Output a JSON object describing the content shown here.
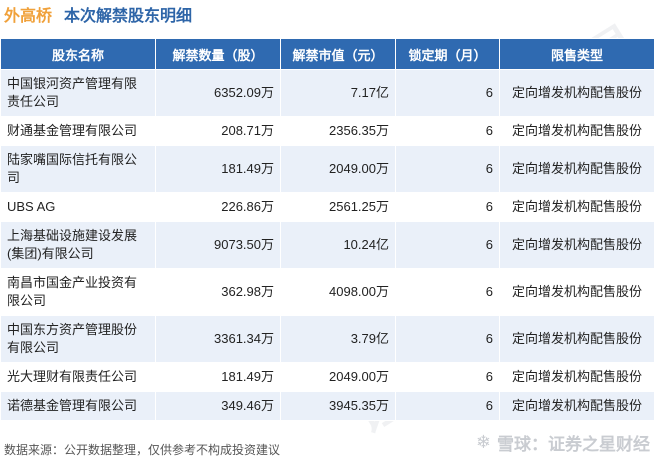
{
  "header": {
    "stock_name": "外高桥",
    "subtitle": "本次解禁股东明细"
  },
  "table": {
    "columns": [
      "股东名称",
      "解禁数量（股）",
      "解禁市值（元）",
      "锁定期（月）",
      "限售类型"
    ],
    "rows": [
      {
        "name": "中国银河资产管理有限责任公司",
        "qty": "6352.09万",
        "value": "7.17亿",
        "lock": "6",
        "type": "定向增发机构配售股份"
      },
      {
        "name": "财通基金管理有限公司",
        "qty": "208.71万",
        "value": "2356.35万",
        "lock": "6",
        "type": "定向增发机构配售股份"
      },
      {
        "name": "陆家嘴国际信托有限公司",
        "qty": "181.49万",
        "value": "2049.00万",
        "lock": "6",
        "type": "定向增发机构配售股份"
      },
      {
        "name": "UBS AG",
        "qty": "226.86万",
        "value": "2561.25万",
        "lock": "6",
        "type": "定向增发机构配售股份"
      },
      {
        "name": "上海基础设施建设发展(集团)有限公司",
        "qty": "9073.50万",
        "value": "10.24亿",
        "lock": "6",
        "type": "定向增发机构配售股份"
      },
      {
        "name": "南昌市国金产业投资有限公司",
        "qty": "362.98万",
        "value": "4098.00万",
        "lock": "6",
        "type": "定向增发机构配售股份"
      },
      {
        "name": "中国东方资产管理股份有限公司",
        "qty": "3361.34万",
        "value": "3.79亿",
        "lock": "6",
        "type": "定向增发机构配售股份"
      },
      {
        "name": "光大理财有限责任公司",
        "qty": "181.49万",
        "value": "2049.00万",
        "lock": "6",
        "type": "定向增发机构配售股份"
      },
      {
        "name": "诺德基金管理有限公司",
        "qty": "349.46万",
        "value": "3945.35万",
        "lock": "6",
        "type": "定向增发机构配售股份"
      }
    ]
  },
  "footer": {
    "source": "数据来源：公开数据整理，仅供参考不构成投资建议"
  },
  "brand": {
    "text": "雪球：证券之星财经"
  },
  "watermark": {
    "text": "证券之星"
  },
  "colors": {
    "header_bg": "#2f6ab1",
    "stripe": "#eaf0f9",
    "title_stock": "#f0a13b",
    "title_sub": "#2e65a8"
  }
}
